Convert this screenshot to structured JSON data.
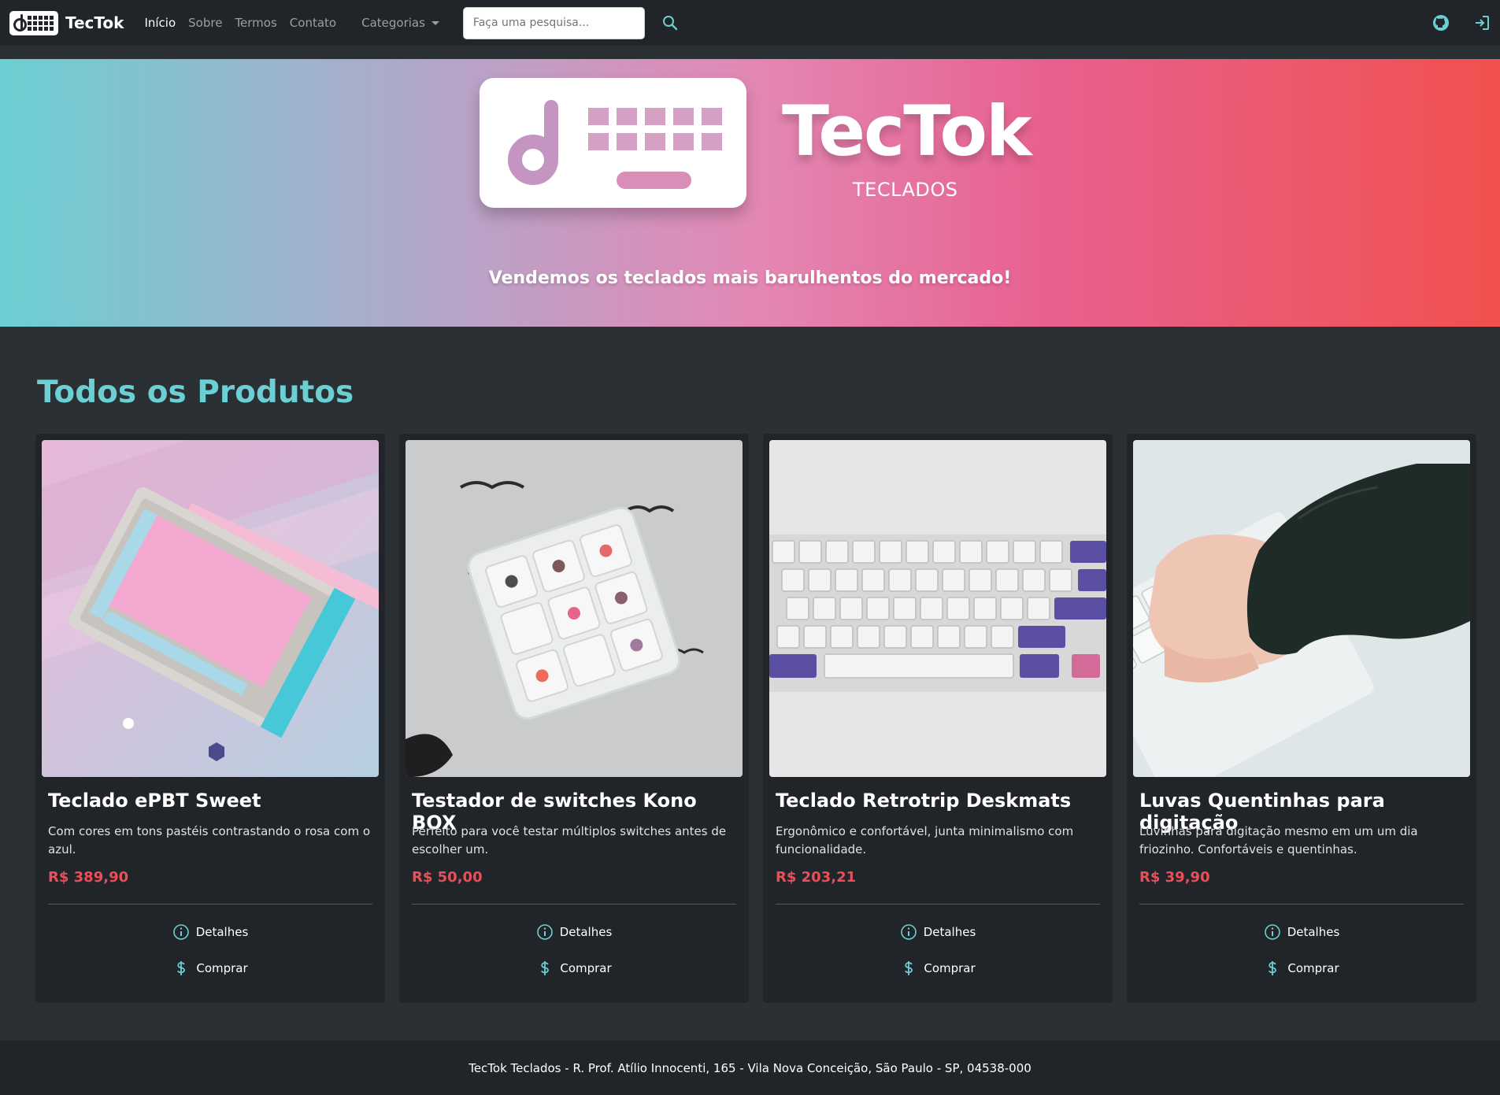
{
  "brand": {
    "name": "TecTok"
  },
  "nav": {
    "links": [
      "Início",
      "Sobre",
      "Termos",
      "Contato"
    ],
    "dropdown_label": "Categorias",
    "search_placeholder": "Faça uma pesquisa..."
  },
  "icons": {
    "search": "search-icon",
    "github": "github-icon",
    "login": "login-icon",
    "details": "info-circle-icon",
    "buy": "dollar-icon"
  },
  "hero": {
    "title": "TecTok",
    "subtitle": "TECLADOS",
    "tagline": "Vendemos os teclados mais barulhentos do mercado!"
  },
  "products_section": {
    "title": "Todos os Produtos"
  },
  "products": [
    {
      "name": "Teclado ePBT Sweet",
      "description": "Com cores em tons pastéis contrastando o rosa com o azul.",
      "price": "R$ 389,90",
      "details_label": "Detalhes",
      "buy_label": "Comprar"
    },
    {
      "name": "Testador de switches Kono BOX",
      "description": "Perfeito para você testar múltiplos switches antes de escolher um.",
      "price": "R$ 50,00",
      "details_label": "Detalhes",
      "buy_label": "Comprar"
    },
    {
      "name": "Teclado Retrotrip Deskmats",
      "description": "Ergonômico e confortável, junta minimalismo com funcionalidade.",
      "price": "R$ 203,21",
      "details_label": "Detalhes",
      "buy_label": "Comprar"
    },
    {
      "name": "Luvas Quentinhas para digitação",
      "description": "Luvinhas para digitação mesmo em um um dia friozinho. Confortáveis e quentinhas.",
      "price": "R$ 39,90",
      "details_label": "Detalhes",
      "buy_label": "Comprar"
    }
  ],
  "footer": {
    "text": "TecTok Teclados - R. Prof. Atílio Innocenti, 165 - Vila Nova Conceição, São Paulo - SP, 04538-000"
  },
  "colors": {
    "accent": "#6ccfd3",
    "price": "#ea4f58",
    "navbar": "#212529",
    "body": "#2b3035"
  }
}
